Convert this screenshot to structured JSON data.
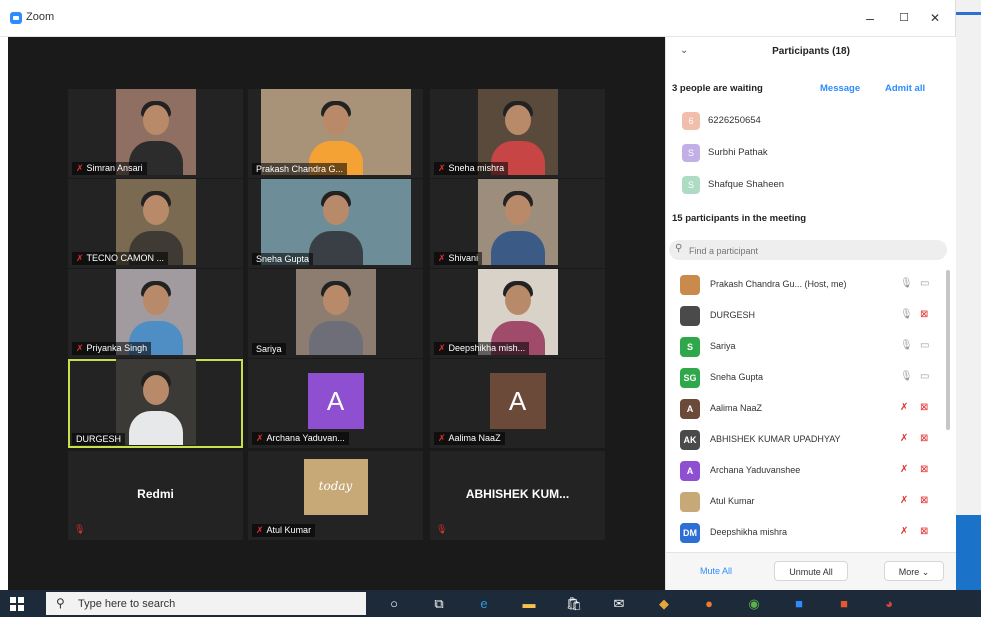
{
  "window": {
    "title": "Zoom",
    "minimize": "–",
    "maximize": "☐",
    "close": "✕"
  },
  "colors": {
    "mute_red": "#e0302e",
    "link_blue": "#2d8cff",
    "active_speaker": "#c8e04a"
  },
  "gallery": [
    {
      "name": "Simran Ansari",
      "muted": true,
      "kind": "photo",
      "bg": "#8e6f62",
      "shirt": "#2c2c2c"
    },
    {
      "name": "Prakash Chandra G...",
      "muted": false,
      "kind": "photo",
      "bg": "#a89278",
      "shirt": "#f4a233"
    },
    {
      "name": "Sneha mishra",
      "muted": true,
      "kind": "photo",
      "bg": "#5a4a3c",
      "shirt": "#c84545"
    },
    {
      "name": "TECNO CAMON ...",
      "muted": true,
      "kind": "photo",
      "bg": "#7a6a52",
      "shirt": "#3f3a34"
    },
    {
      "name": "Sneha Gupta",
      "muted": false,
      "kind": "photo",
      "bg": "#6d8e98",
      "shirt": "#3a3f45"
    },
    {
      "name": "Shivani",
      "muted": true,
      "kind": "photo",
      "bg": "#9c8d7c",
      "shirt": "#3b5b86"
    },
    {
      "name": "Priyanka Singh",
      "muted": true,
      "kind": "photo",
      "bg": "#a19ba0",
      "shirt": "#4e8ec4"
    },
    {
      "name": "Sariya",
      "muted": false,
      "kind": "photo",
      "bg": "#8d7d70",
      "shirt": "#6e6e78"
    },
    {
      "name": "Deepshikha mish...",
      "muted": true,
      "kind": "photo",
      "bg": "#d8d2c9",
      "shirt": "#a14b6b"
    },
    {
      "name": "DURGESH",
      "muted": false,
      "kind": "photo",
      "bg": "#3b3a36",
      "shirt": "#e6e8ea",
      "active": true
    },
    {
      "name": "Archana Yaduvan...",
      "muted": true,
      "kind": "avatar",
      "letter": "A",
      "color": "#8f4fd1"
    },
    {
      "name": "Aalima NaaZ",
      "muted": true,
      "kind": "avatar",
      "letter": "A",
      "color": "#6b4a3a"
    },
    {
      "name": "Redmi",
      "muted": true,
      "kind": "nameonly"
    },
    {
      "name": "Atul Kumar",
      "muted": true,
      "kind": "image",
      "caption": "today"
    },
    {
      "name": "ABHISHEK KUM...",
      "muted": true,
      "kind": "nameonly"
    }
  ],
  "panel": {
    "title": "Participants (18)",
    "waiting_text": "3 people are waiting",
    "message_label": "Message",
    "admit_all_label": "Admit all",
    "waiting": [
      {
        "initial": "6",
        "name": "6226250654",
        "color": "#e88a6a"
      },
      {
        "initial": "S",
        "name": "Surbhi Pathak",
        "color": "#8f6fd1"
      },
      {
        "initial": "S",
        "name": "Shafque Shaheen",
        "color": "#6cbf93"
      }
    ],
    "in_meeting_text": "15 participants in the meeting",
    "search_placeholder": "Find a participant",
    "participants": [
      {
        "initial": "",
        "name": "Prakash Chandra Gu...  (Host, me)",
        "color": "#c98a4b",
        "mic": "on",
        "cam": "on"
      },
      {
        "initial": "",
        "name": "DURGESH",
        "color": "#4a4a4a",
        "mic": "on",
        "cam": "off"
      },
      {
        "initial": "S",
        "name": "Sariya",
        "color": "#2ea84a",
        "mic": "on",
        "cam": "on"
      },
      {
        "initial": "SG",
        "name": "Sneha Gupta",
        "color": "#2ea84a",
        "mic": "on",
        "cam": "on"
      },
      {
        "initial": "A",
        "name": "Aalima NaaZ",
        "color": "#6b4a3a",
        "mic": "off",
        "cam": "off"
      },
      {
        "initial": "AK",
        "name": "ABHISHEK KUMAR UPADHYAY",
        "color": "#4a4a4a",
        "mic": "off",
        "cam": "off"
      },
      {
        "initial": "A",
        "name": "Archana Yaduvanshee",
        "color": "#8f4fd1",
        "mic": "off",
        "cam": "off"
      },
      {
        "initial": "",
        "name": "Atul Kumar",
        "color": "#c7a877",
        "mic": "off",
        "cam": "off"
      },
      {
        "initial": "DM",
        "name": "Deepshikha mishra",
        "color": "#2d6fd4",
        "mic": "off",
        "cam": "off"
      }
    ],
    "footer": {
      "mute_all": "Mute All",
      "unmute_all": "Unmute All",
      "more": "More ⌄"
    }
  },
  "taskbar": {
    "search_placeholder": "Type here to search",
    "icons": [
      {
        "name": "cortana-icon",
        "glyph": "○",
        "color": "#ffffff"
      },
      {
        "name": "task-view-icon",
        "glyph": "⧉",
        "color": "#ffffff"
      },
      {
        "name": "edge-icon",
        "glyph": "e",
        "color": "#2d9cdb"
      },
      {
        "name": "file-explorer-icon",
        "glyph": "▬",
        "color": "#f2c14e"
      },
      {
        "name": "store-icon",
        "glyph": "🛍",
        "color": "#ffffff"
      },
      {
        "name": "mail-icon",
        "glyph": "✉",
        "color": "#ffffff"
      },
      {
        "name": "app-icon",
        "glyph": "◆",
        "color": "#e5a73c"
      },
      {
        "name": "firefox-icon",
        "glyph": "●",
        "color": "#f37a2d"
      },
      {
        "name": "app2-icon",
        "glyph": "◉",
        "color": "#5ab14b"
      },
      {
        "name": "zoom-icon",
        "glyph": "■",
        "color": "#2d8cff"
      },
      {
        "name": "app3-icon",
        "glyph": "■",
        "color": "#e8572c"
      },
      {
        "name": "chrome-icon",
        "glyph": "◕",
        "color": "#d9463b"
      }
    ]
  }
}
